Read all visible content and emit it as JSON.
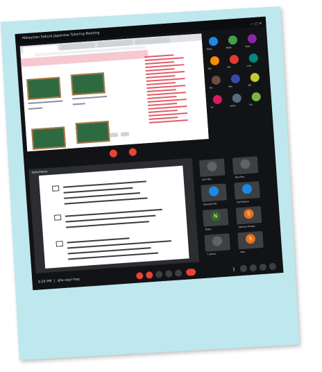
{
  "window_title": "Malaysian Sakura Japanese Tutoring Meeting",
  "top_shared": {
    "tabs": [
      "Japanese",
      "Lesson",
      "Lesson",
      "Lesson"
    ]
  },
  "participants_top": [
    {
      "name": "Kinja",
      "color": "#1e88e5"
    },
    {
      "name": "Malla",
      "color": "#43a047"
    },
    {
      "name": "Nino",
      "color": "#8e24aa"
    },
    {
      "name": "Ayu",
      "color": "#fb8c00"
    },
    {
      "name": "Siti",
      "color": "#e53935"
    },
    {
      "name": "Lina",
      "color": "#00897b"
    },
    {
      "name": "Rin",
      "color": "#6d4c41"
    },
    {
      "name": "Mei",
      "color": "#3949ab"
    },
    {
      "name": "Aki",
      "color": "#c0ca33"
    },
    {
      "name": "Yui",
      "color": "#d81b60"
    },
    {
      "name": "Hana",
      "color": "#546e7a"
    },
    {
      "name": "Kai",
      "color": "#7cb342"
    }
  ],
  "shared_screen_label": "Doho'Hesto",
  "participants_bottom": [
    {
      "name": "Lane Ryo",
      "initial": "",
      "color": "#5f6368"
    },
    {
      "name": "Rere Ryo",
      "initial": "",
      "color": "#5f6368"
    },
    {
      "name": "Ramesh Pekr",
      "initial": "",
      "color": "#1e88e5"
    },
    {
      "name": "Puji Mutiara",
      "initial": "",
      "color": "#1e88e5"
    },
    {
      "name": "Nabyi",
      "initial": "N",
      "color": "#33691e"
    },
    {
      "name": "Sekrima Pronga",
      "initial": "S",
      "color": "#e8711a"
    },
    {
      "name": "7 others",
      "initial": "",
      "color": "#5f6368"
    },
    {
      "name": "Yoso",
      "initial": "S",
      "color": "#e8711a"
    }
  ],
  "bottom_bar": {
    "time": "3:20 PM",
    "meeting_code": "qfw-vqyr-hay"
  }
}
